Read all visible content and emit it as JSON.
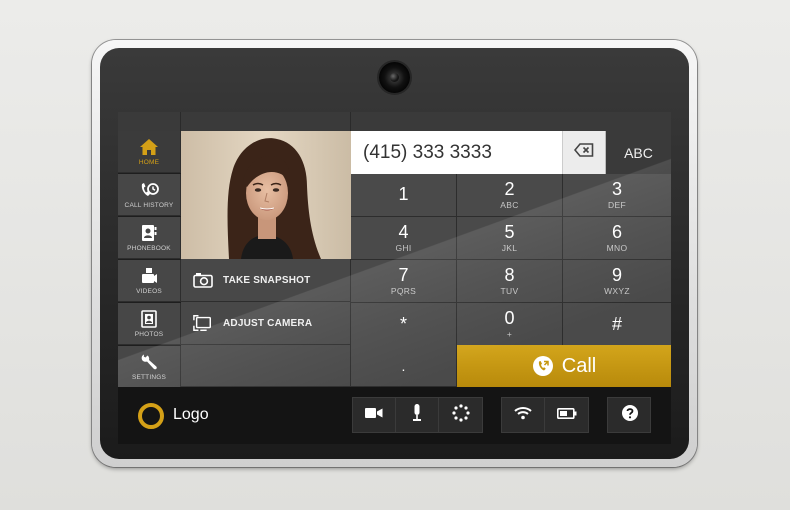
{
  "sidebar": {
    "items": [
      {
        "label": "HOME",
        "icon": "home-icon",
        "active": true
      },
      {
        "label": "CALL HISTORY",
        "icon": "call-history-icon"
      },
      {
        "label": "PHONEBOOK",
        "icon": "phonebook-icon"
      },
      {
        "label": "VIDEOS",
        "icon": "videos-icon"
      },
      {
        "label": "PHOTOS",
        "icon": "photos-icon"
      },
      {
        "label": "SETTINGS",
        "icon": "wrench-icon"
      }
    ]
  },
  "actions": {
    "take_snapshot": "TAKE SNAPSHOT",
    "adjust_camera": "ADJUST CAMERA"
  },
  "dialer": {
    "number": "(415) 333 3333",
    "abc_label": "ABC",
    "keys": [
      {
        "digit": "1",
        "letters": ""
      },
      {
        "digit": "2",
        "letters": "ABC"
      },
      {
        "digit": "3",
        "letters": "DEF"
      },
      {
        "digit": "4",
        "letters": "GHI"
      },
      {
        "digit": "5",
        "letters": "JKL"
      },
      {
        "digit": "6",
        "letters": "MNO"
      },
      {
        "digit": "7",
        "letters": "PQRS"
      },
      {
        "digit": "8",
        "letters": "TUV"
      },
      {
        "digit": "9",
        "letters": "WXYZ"
      },
      {
        "digit": "*",
        "letters": ""
      },
      {
        "digit": "0",
        "letters": "+"
      },
      {
        "digit": "#",
        "letters": ""
      },
      {
        "digit": ".",
        "letters": ""
      }
    ],
    "call_label": "Call"
  },
  "bottombar": {
    "logo_text": "Logo",
    "toolbar": [
      "video-camera-icon",
      "microphone-icon",
      "loading-spinner-icon",
      "wifi-icon",
      "battery-icon",
      "help-icon"
    ]
  },
  "colors": {
    "accent": "#d4a017",
    "panel": "#4a4a4a",
    "dark": "#141414"
  }
}
